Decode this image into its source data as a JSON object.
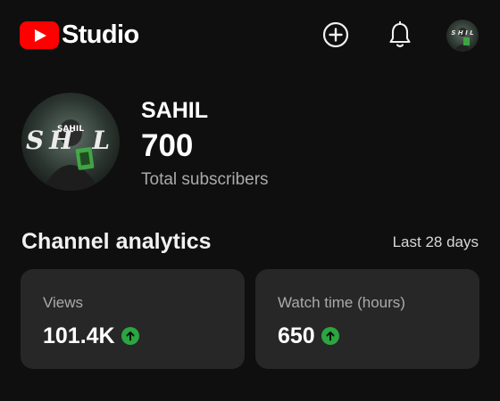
{
  "header": {
    "brand": "Studio",
    "create_icon": "add-circle-icon",
    "notifications_icon": "bell-icon",
    "account_icon": "avatar",
    "brand_color": "#ff0000"
  },
  "channel": {
    "name": "SAHIL",
    "subscriber_count": "700",
    "subscriber_label": "Total subscribers",
    "avatar_text": "SAHIL"
  },
  "analytics": {
    "title": "Channel analytics",
    "range": "Last 28 days",
    "trend_color": "#2ba640",
    "metrics": [
      {
        "label": "Views",
        "value": "101.4K",
        "trend": "up"
      },
      {
        "label": "Watch time (hours)",
        "value": "650",
        "trend": "up"
      }
    ]
  }
}
